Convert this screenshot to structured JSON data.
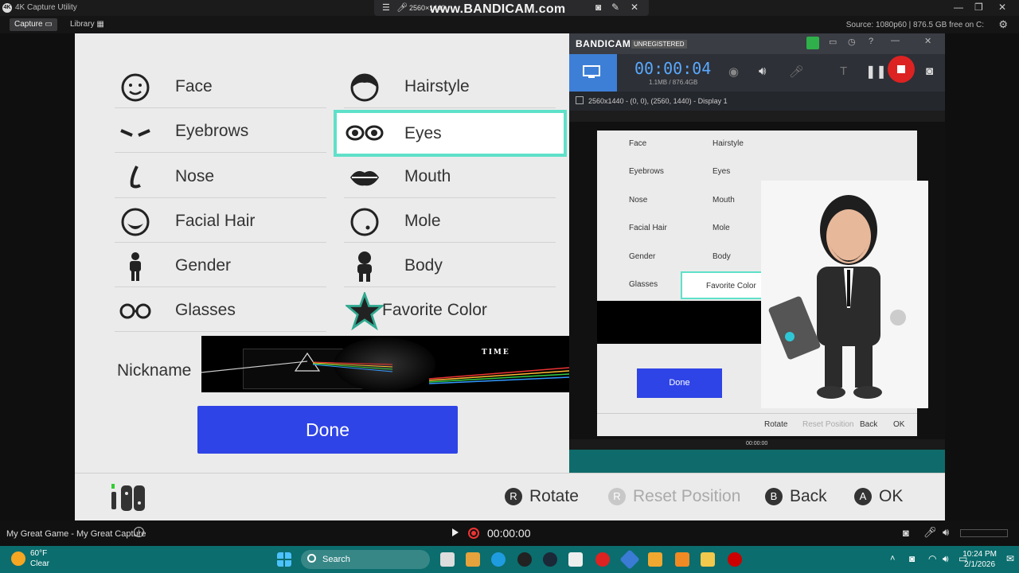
{
  "titlebar": {
    "app_title": "4K Capture Utility",
    "logo_text": "4K",
    "bandicam_watermark": "www.BANDICAM.com",
    "resolution": "2560×1440"
  },
  "toolbar": {
    "tab_capture": "Capture",
    "tab_library": "Library",
    "source_info": "Source: 1080p60  |  876.5 GB free on C:"
  },
  "menu": {
    "left": [
      {
        "label": "Face",
        "icon": "face-icon"
      },
      {
        "label": "Eyebrows",
        "icon": "eyebrows-icon"
      },
      {
        "label": "Nose",
        "icon": "nose-icon"
      },
      {
        "label": "Facial Hair",
        "icon": "facial-hair-icon"
      },
      {
        "label": "Gender",
        "icon": "gender-icon"
      },
      {
        "label": "Glasses",
        "icon": "glasses-icon"
      }
    ],
    "right": [
      {
        "label": "Hairstyle",
        "icon": "hairstyle-icon"
      },
      {
        "label": "Eyes",
        "icon": "eyes-icon"
      },
      {
        "label": "Mouth",
        "icon": "mouth-icon"
      },
      {
        "label": "Mole",
        "icon": "mole-icon"
      },
      {
        "label": "Body",
        "icon": "body-icon"
      },
      {
        "label": "Favorite Color",
        "icon": "star-icon"
      }
    ],
    "nickname_label": "Nickname",
    "done_label": "Done",
    "album_title": "TIME"
  },
  "bottombar": {
    "rotate": "Rotate",
    "rotate_key": "R",
    "reset": "Reset Position",
    "reset_key": "R",
    "back": "Back",
    "back_key": "B",
    "ok": "OK",
    "ok_key": "A"
  },
  "bandicam": {
    "brand": "BANDICAM",
    "unregistered": "UNREGISTERED",
    "timer": "00:00:04",
    "size": "1.1MB / 876.4GB",
    "area": "2560x1440 - (0, 0), (2560, 1440) - Display 1"
  },
  "nested": {
    "items_left": [
      "Face",
      "Eyebrows",
      "Nose",
      "Facial Hair",
      "Gender",
      "Glasses"
    ],
    "items_right": [
      "Hairstyle",
      "Eyes",
      "Mouth",
      "Mole",
      "Body",
      "Favorite Color"
    ],
    "done": "Done",
    "rotate": "Rotate",
    "reset": "Reset Position",
    "back": "Back",
    "ok": "OK",
    "time": "00:00:00"
  },
  "statusbar": {
    "capture_name": "My Great Game - My Great Capture",
    "timecode": "00:00:00"
  },
  "taskbar": {
    "temp": "60°F",
    "condition": "Clear",
    "search_label": "Search",
    "time": "10:24 PM",
    "date": "2/1/2026"
  },
  "colors": {
    "accent_teal": "#5fe0c9",
    "done_blue": "#2f44e6",
    "rec_red": "#d22222",
    "taskbar": "#0b6d6d"
  }
}
